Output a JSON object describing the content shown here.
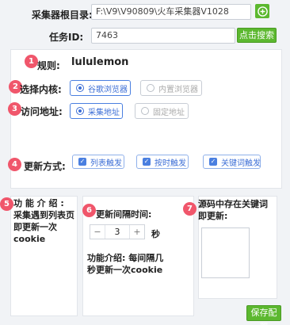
{
  "collector": {
    "label": "采集器根目录:",
    "path": "F:\\V9\\V90809\\火车采集器V1028",
    "add_icon": "plus-circle-icon"
  },
  "task": {
    "label": "任务ID:",
    "id": "7463",
    "search_button": "点击搜索"
  },
  "rule": {
    "badge": "1",
    "label": "规则:",
    "value": "lululemon"
  },
  "kernel": {
    "badge": "2",
    "label": "选择内核:",
    "options": [
      "谷歌浏览器",
      "内置浏览器"
    ],
    "selected": "谷歌浏览器"
  },
  "address": {
    "badge": "3",
    "label": "访问地址:",
    "options": [
      "采集地址",
      "固定地址"
    ],
    "selected": "采集地址"
  },
  "update_mode": {
    "badge": "4",
    "label": "更新方式:",
    "options": [
      "列表触发",
      "按时触发",
      "关键词触发"
    ]
  },
  "intro5": {
    "badge": "5",
    "text_line1": "功 能 介 绍 :",
    "text_line2": "采集遇到列表页",
    "text_line3": "即更新一次",
    "text_line4": "cookie"
  },
  "interval": {
    "badge": "6",
    "label": "更新间隔时间:",
    "minus": "−",
    "value": "3",
    "plus": "+",
    "unit": "秒",
    "desc_line1": "功能介绍: 每间隔几",
    "desc_line2": "秒更新一次cookie"
  },
  "keyword": {
    "badge": "7",
    "label_line1": "源码中存在关键词",
    "label_line2": "即更新:",
    "value": ""
  },
  "save_button": "保存配置",
  "colors": {
    "accent_green": "#5cb82f",
    "badge_red": "#f0566b",
    "active_blue": "#3d6fd6"
  }
}
